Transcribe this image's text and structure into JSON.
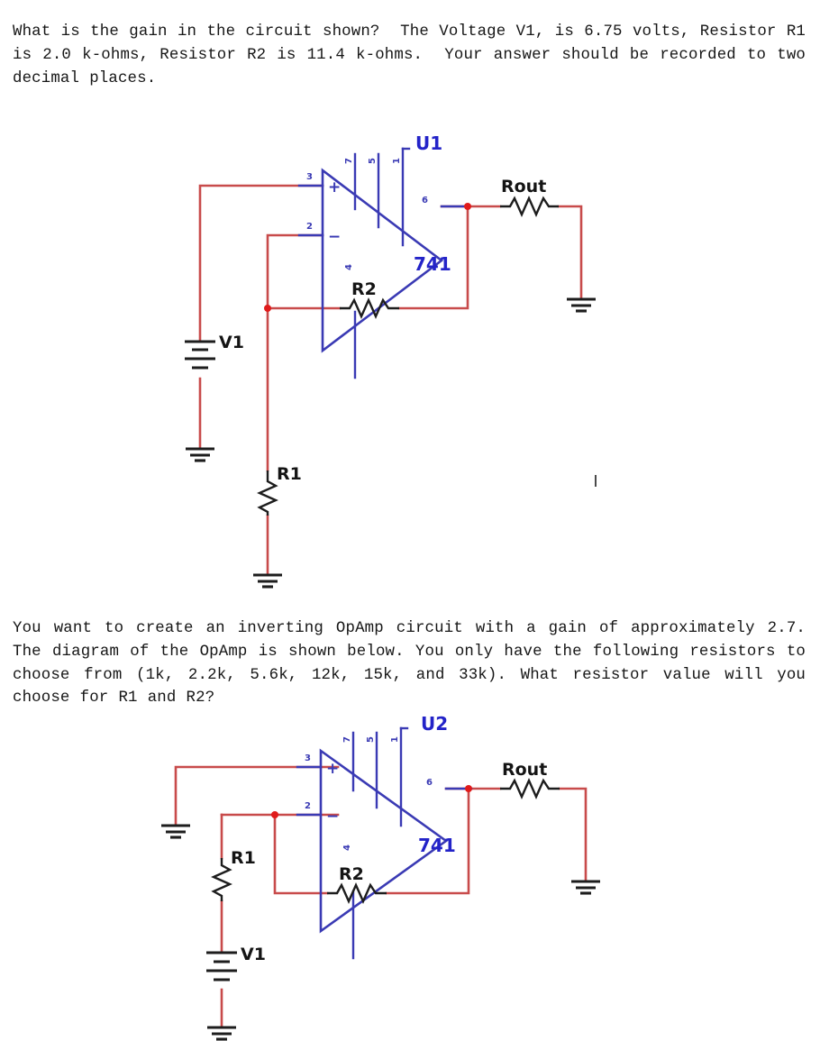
{
  "document": {
    "kind": "electronics-homework-questions"
  },
  "questions": [
    {
      "id": "q1",
      "text": "What is the gain in the circuit shown?  The Voltage V1, is 6.75 volts, Resistor R1 is 2.0 k-ohms, Resistor R2 is 11.4 k-ohms.  Your answer should be recorded to two decimal places."
    },
    {
      "id": "q2",
      "text": "You want to create an inverting OpAmp circuit with a gain of approximately 2.7.  The diagram of the OpAmp is shown below. You only have the following resistors to choose from (1k, 2.2k, 5.6k, 12k, 15k, and 33k). What resistor value will you choose for R1 and R2?"
    }
  ],
  "colors": {
    "wire_red": "#c84b4b",
    "pin_blue": "#3a3ab4",
    "label_blue": "#2323c8",
    "node_red": "#e01b1b",
    "component_black": "#1d1d1d",
    "text_black": "#161616",
    "background": "#ffffff"
  },
  "circuit_1": {
    "name": "non-inverting-opamp-circuit",
    "opamp": {
      "designator": "U1",
      "part_number": "741",
      "plus_symbol": "+",
      "minus_symbol": "−",
      "pins": {
        "non_inverting": "3",
        "inverting": "2",
        "output": "6",
        "v_plus": "7",
        "offset_null_a": "5",
        "offset_null_b": "1",
        "v_minus": "4"
      }
    },
    "components": [
      {
        "ref": "V1",
        "type": "battery",
        "label": "V1"
      },
      {
        "ref": "R1",
        "type": "resistor",
        "label": "R1"
      },
      {
        "ref": "R2",
        "type": "resistor",
        "label": "R2"
      },
      {
        "ref": "Rout",
        "type": "resistor",
        "label": "Rout"
      }
    ],
    "grounds": 3
  },
  "circuit_2": {
    "name": "inverting-opamp-circuit",
    "opamp": {
      "designator": "U2",
      "part_number": "741",
      "plus_symbol": "+",
      "minus_symbol": "−",
      "pins": {
        "non_inverting": "3",
        "inverting": "2",
        "output": "6",
        "v_plus": "7",
        "offset_null_a": "5",
        "offset_null_b": "1",
        "v_minus": "4"
      }
    },
    "components": [
      {
        "ref": "R1",
        "type": "resistor",
        "label": "R1"
      },
      {
        "ref": "R2",
        "type": "resistor",
        "label": "R2"
      },
      {
        "ref": "Rout",
        "type": "resistor",
        "label": "Rout"
      },
      {
        "ref": "V1",
        "type": "battery",
        "label": "V1"
      }
    ],
    "grounds": 3
  }
}
